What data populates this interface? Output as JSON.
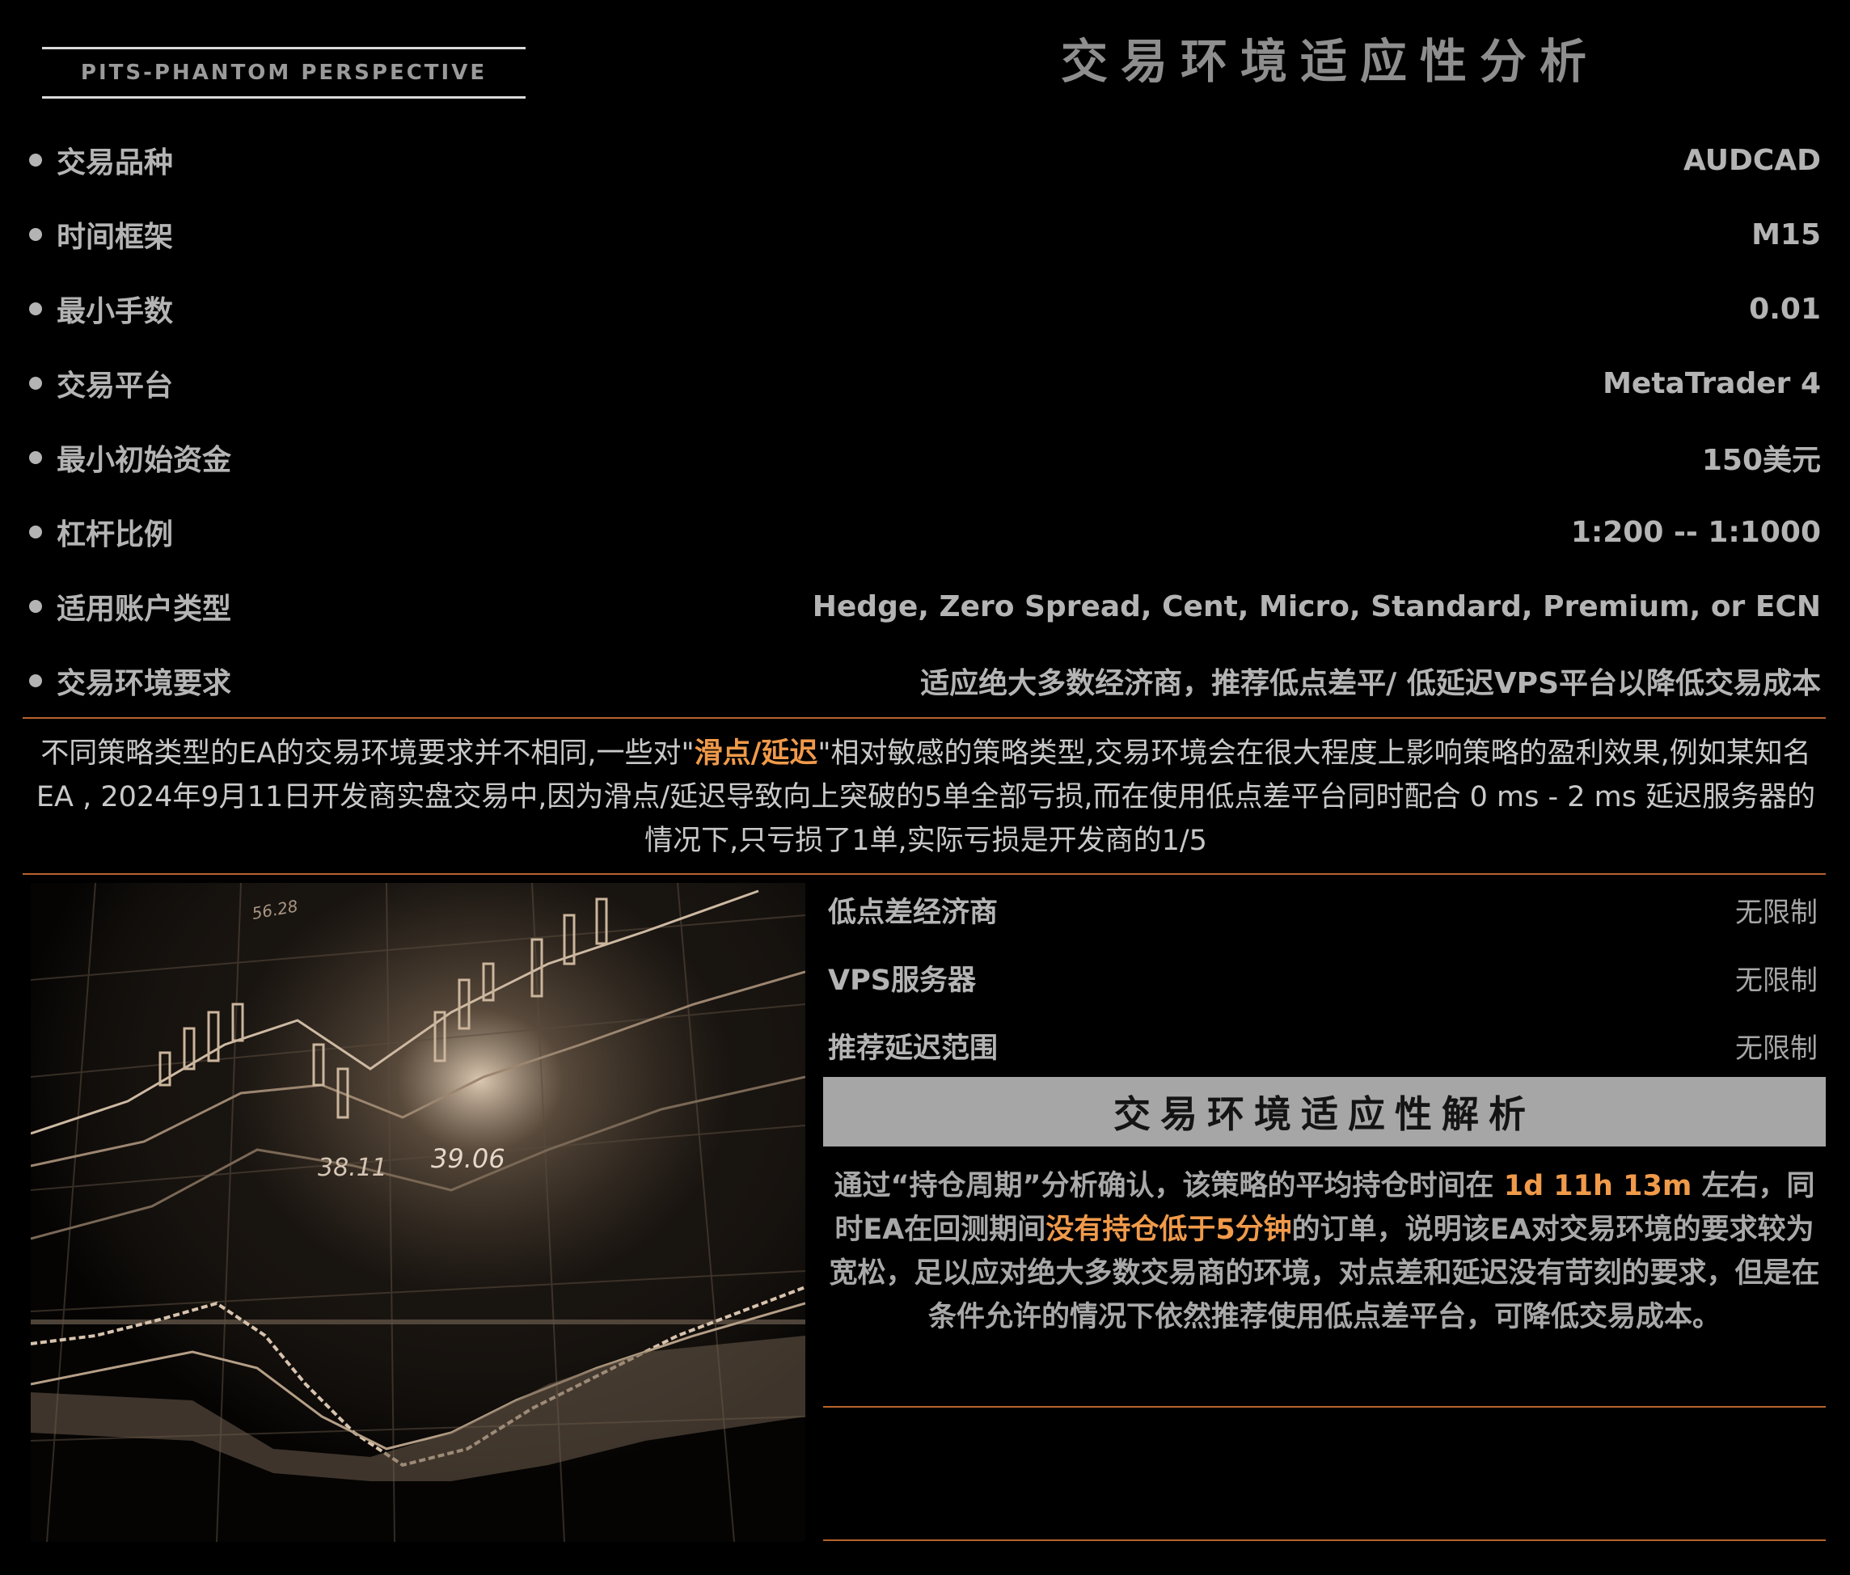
{
  "logo": {
    "text": "PITS-PHANTOM PERSPECTIVE"
  },
  "title": "交易环境适应性分析",
  "specs": [
    {
      "label": "交易品种",
      "value": "AUDCAD"
    },
    {
      "label": "时间框架",
      "value": "M15"
    },
    {
      "label": "最小手数",
      "value": "0.01"
    },
    {
      "label": "交易平台",
      "value": "MetaTrader 4"
    },
    {
      "label": "最小初始资金",
      "value": "150美元"
    },
    {
      "label": "杠杆比例",
      "value": "1:200 -- 1:1000"
    },
    {
      "label": "适用账户类型",
      "value": "Hedge, Zero Spread, Cent, Micro, Standard, Premium, or ECN"
    },
    {
      "label": "交易环境要求",
      "value": "适应绝大多数经济商，推荐低点差平/ 低延迟VPS平台以降低交易成本"
    }
  ],
  "note": {
    "part1": "不同策略类型的EA的交易环境要求并不相同,一些对\"",
    "highlight": "滑点/延迟",
    "part2": "\"相对敏感的策略类型,交易环境会在很大程度上影响策略的盈利效果,例如某知名 EA , 2024年9月11日开发商实盘交易中,因为滑点/延迟导致向上突破的5单全部亏损,而在使用低点差平台同时配合 0 ms - 2 ms 延迟服务器的情况下,只亏损了1单,实际亏损是开发商的1/5"
  },
  "chart_image": {
    "labels": [
      "56.28",
      "38.11",
      "39.06"
    ]
  },
  "environment": [
    {
      "label": "低点差经济商",
      "value": "无限制"
    },
    {
      "label": "VPS服务器",
      "value": "无限制"
    },
    {
      "label": "推荐延迟范围",
      "value": "无限制"
    }
  ],
  "analysis": {
    "title": "交易环境适应性解析",
    "t1": "通过“持仓周期”分析确认，该策略的平均持仓时间在 ",
    "h1": "1d 11h 13m",
    "t2": " 左右，同时EA在回测期间",
    "h2": "没有持仓低于5分钟",
    "t3": "的订单，说明该EA对交易环境的要求较为宽松，足以应对绝大多数交易商的环境，对点差和延迟没有苛刻的要求，但是在条件允许的情况下依然推荐使用低点差平台，可降低交易成本。"
  },
  "colors": {
    "accent": "#f09a4a",
    "divider": "#b8642c",
    "bar": "#a6a6a6"
  }
}
